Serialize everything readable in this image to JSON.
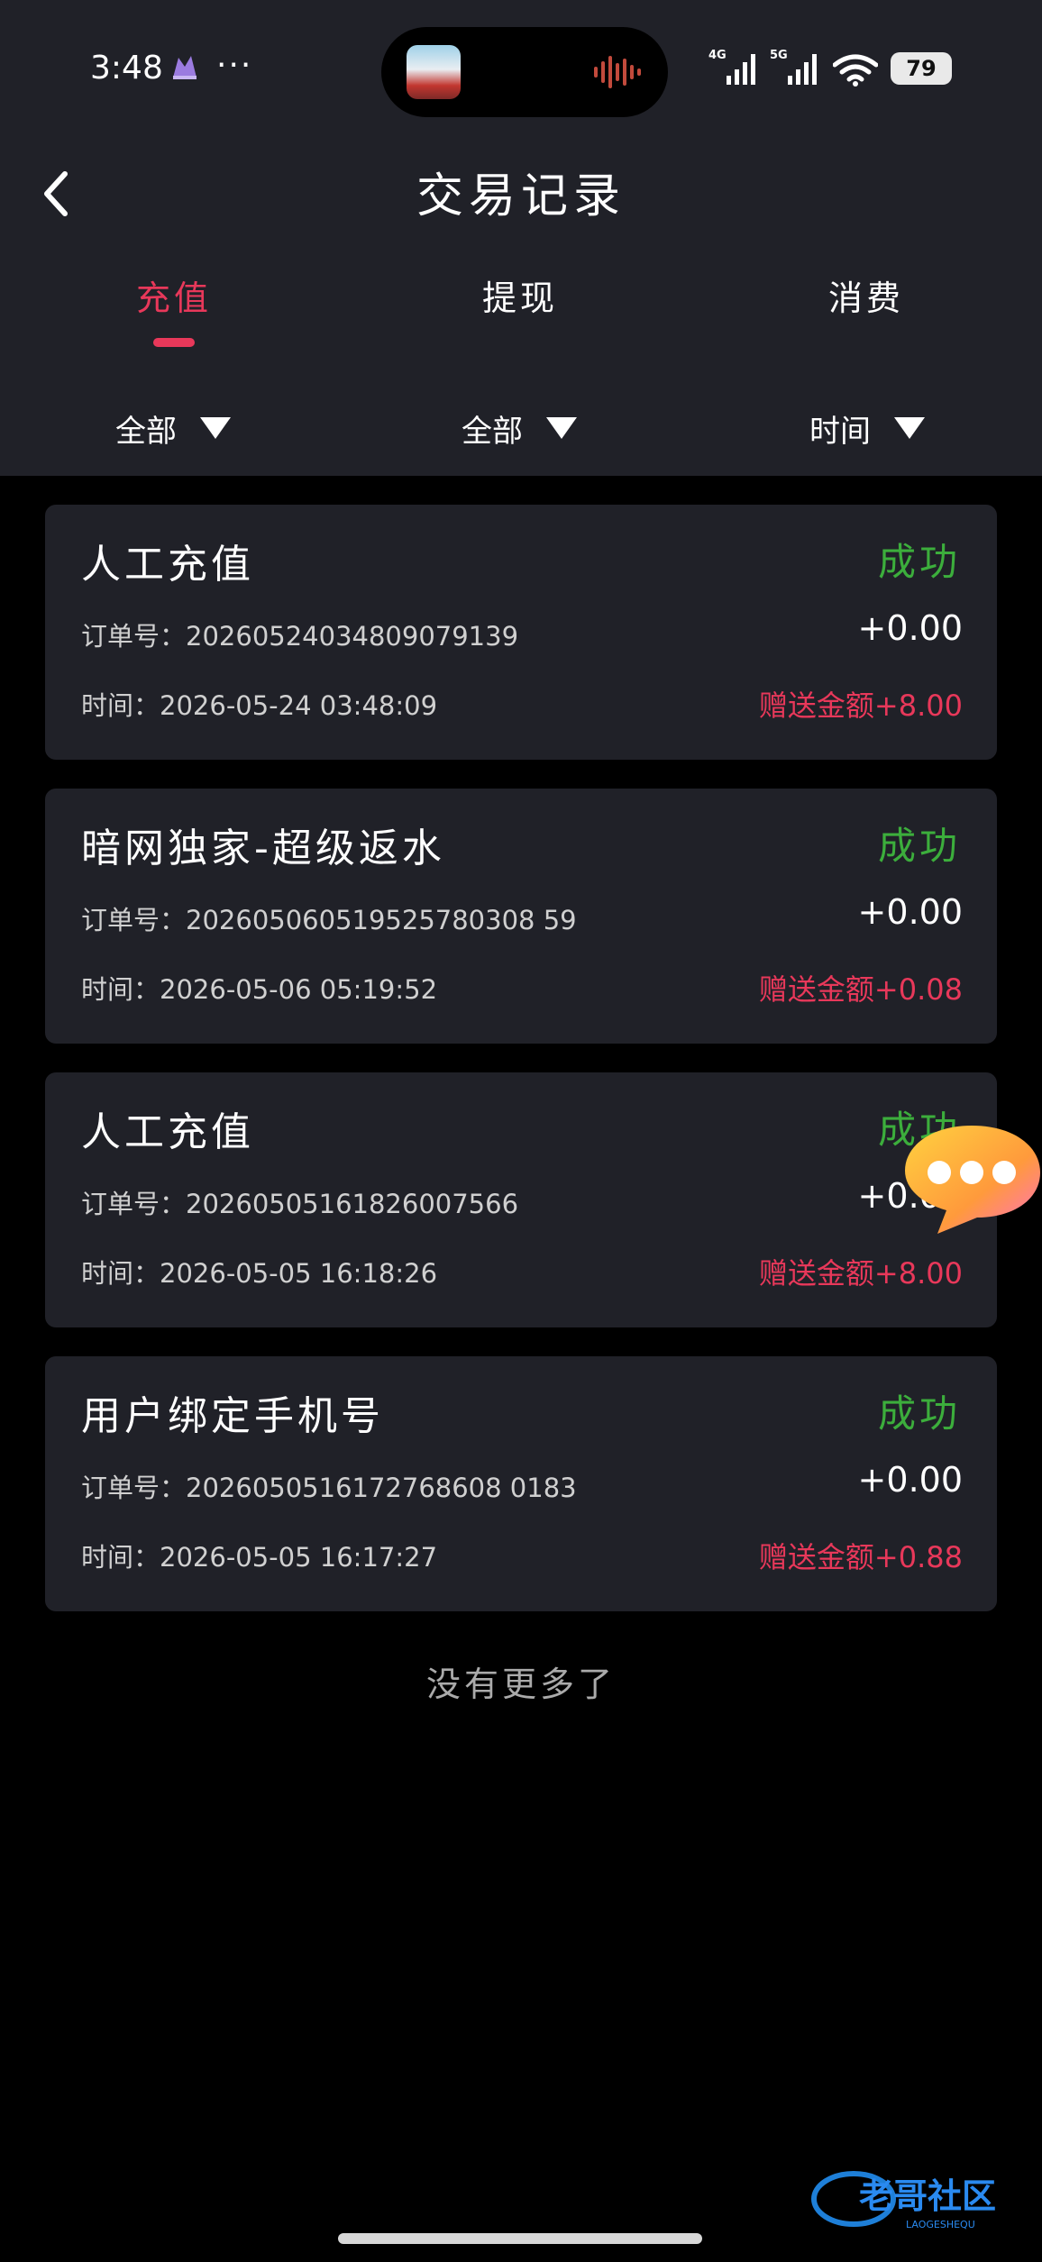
{
  "status_bar": {
    "time": "3:48",
    "battery": "79",
    "net1": "4G",
    "net2": "5G"
  },
  "header": {
    "title": "交易记录",
    "tabs": [
      {
        "label": "充值",
        "active": true
      },
      {
        "label": "提现",
        "active": false
      },
      {
        "label": "消费",
        "active": false
      }
    ],
    "filters": [
      "全部",
      "全部",
      "时间"
    ]
  },
  "records": [
    {
      "title": "人工充值",
      "status": "成功",
      "order_label": "订单号：",
      "order_no": "20260524034809079139",
      "amount": "+0.00",
      "time_label": "时间：",
      "time": "2026-05-24 03:48:09",
      "bonus": "赠送金额+8.00"
    },
    {
      "title": "暗网独家-超级返水",
      "status": "成功",
      "order_label": "订单号：",
      "order_no": "202605060519525780308 59",
      "amount": "+0.00",
      "time_label": "时间：",
      "time": "2026-05-06 05:19:52",
      "bonus": "赠送金额+0.08"
    },
    {
      "title": "人工充值",
      "status": "成功",
      "order_label": "订单号：",
      "order_no": "20260505161826007566",
      "amount": "+0.00",
      "time_label": "时间：",
      "time": "2026-05-05 16:18:26",
      "bonus": "赠送金额+8.00"
    },
    {
      "title": "用户绑定手机号",
      "status": "成功",
      "order_label": "订单号：",
      "order_no": "2026050516172768608 0183",
      "amount": "+0.00",
      "time_label": "时间：",
      "time": "2026-05-05 16:17:27",
      "bonus": "赠送金额+0.88"
    }
  ],
  "footer": {
    "no_more": "没有更多了",
    "watermark": "老哥社区",
    "watermark_sub": "LAOGESHEQU"
  },
  "colors": {
    "accent": "#e8385a",
    "success": "#3cae3c",
    "card_bg": "#202128",
    "page_bg": "#000000"
  },
  "icons": {
    "back": "chevron-left-icon",
    "dropdown": "triangle-down-icon",
    "chat": "chat-bubble-icon",
    "wifi": "wifi-icon",
    "signal": "signal-icon"
  }
}
